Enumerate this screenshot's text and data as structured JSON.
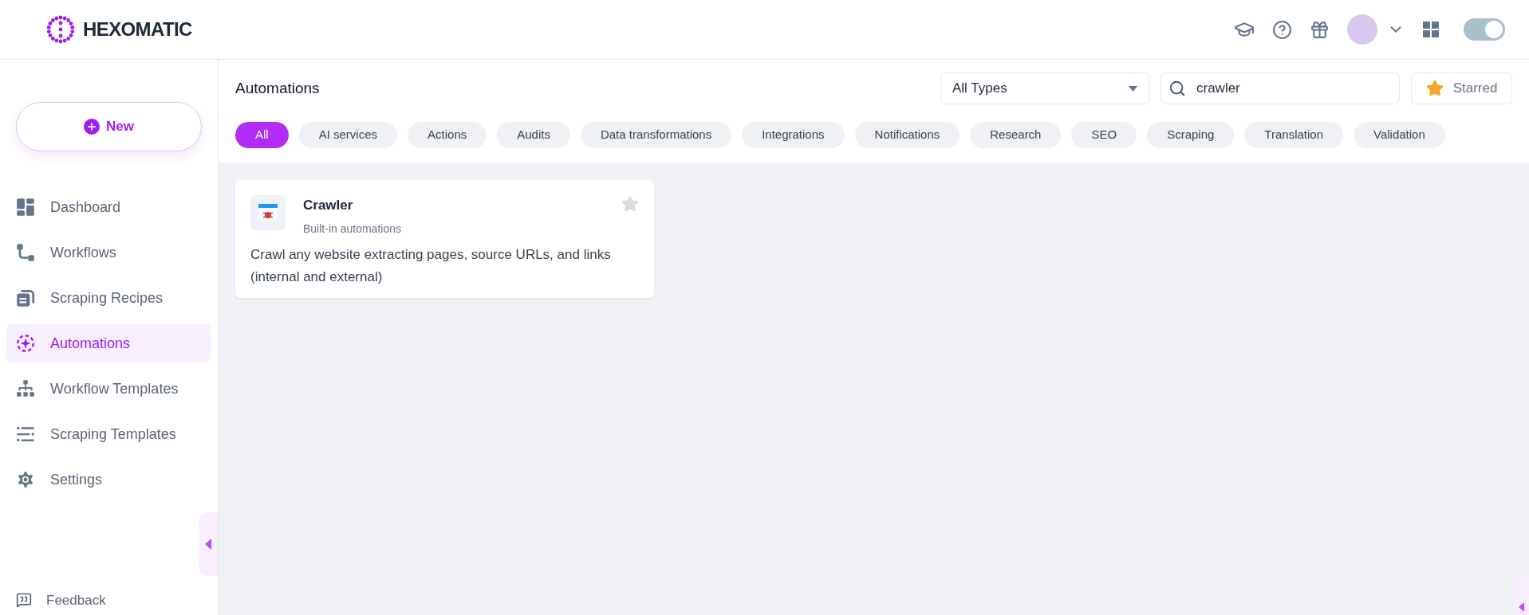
{
  "header": {
    "logo": "HEXOMATIC",
    "theme_toggle": {
      "on": true
    }
  },
  "sidebar": {
    "new_button": "New",
    "items": [
      {
        "label": "Dashboard",
        "kind": "dashboard",
        "selected": false
      },
      {
        "label": "Workflows",
        "kind": "workflow",
        "selected": false
      },
      {
        "label": "Scraping Recipes",
        "kind": "recipes",
        "selected": false
      },
      {
        "label": "Automations",
        "kind": "automation",
        "selected": true
      },
      {
        "label": "Workflow Templates",
        "kind": "tree",
        "selected": false
      },
      {
        "label": "Scraping Templates",
        "kind": "list",
        "selected": false
      },
      {
        "label": "Settings",
        "kind": "gear",
        "selected": false
      }
    ],
    "feedback": "Feedback"
  },
  "toolbar": {
    "title": "Automations",
    "type_select": "All Types",
    "search": "crawler",
    "starred_button": "Starred"
  },
  "categories": [
    {
      "label": "All",
      "selected": true
    },
    {
      "label": "AI services",
      "selected": false
    },
    {
      "label": "Actions",
      "selected": false
    },
    {
      "label": "Audits",
      "selected": false
    },
    {
      "label": "Data transformations",
      "selected": false
    },
    {
      "label": "Integrations",
      "selected": false
    },
    {
      "label": "Notifications",
      "selected": false
    },
    {
      "label": "Research",
      "selected": false
    },
    {
      "label": "SEO",
      "selected": false
    },
    {
      "label": "Scraping",
      "selected": false
    },
    {
      "label": "Translation",
      "selected": false
    },
    {
      "label": "Validation",
      "selected": false
    }
  ],
  "cards": [
    {
      "title": "Crawler",
      "subtitle": "Built-in automations",
      "description": "Crawl any website extracting pages, source URLs, and links (internal and external)",
      "starred": false
    }
  ]
}
